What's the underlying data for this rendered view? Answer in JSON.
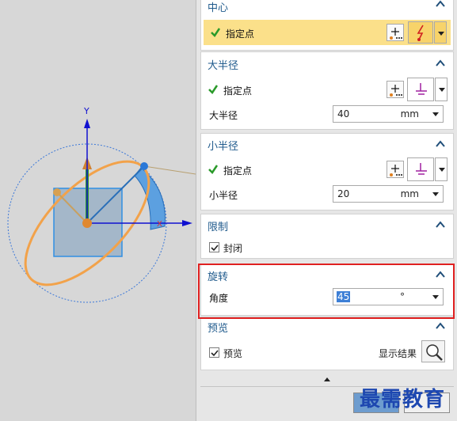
{
  "sections": {
    "center": {
      "title": "中心",
      "specify_point_label": "指定点"
    },
    "major_radius": {
      "title": "大半径",
      "specify_point_label": "指定点",
      "radius_label": "大半径",
      "radius_value": "40",
      "radius_unit": "mm"
    },
    "minor_radius": {
      "title": "小半径",
      "specify_point_label": "指定点",
      "radius_label": "小半径",
      "radius_value": "20",
      "radius_unit": "mm"
    },
    "limit": {
      "title": "限制",
      "closed_label": "封闭",
      "closed_checked": true
    },
    "rotation": {
      "title": "旋转",
      "angle_label": "角度",
      "angle_value": "45",
      "angle_unit": "°"
    },
    "preview": {
      "title": "预览",
      "preview_label": "预览",
      "preview_checked": true,
      "show_result_label": "显示结果"
    }
  },
  "viewport": {
    "y_axis_label": "Y",
    "x_axis_label": "X"
  },
  "watermark": "最需教育",
  "colors": {
    "accent": "#1f5a8c",
    "active_row": "#fbe08a",
    "highlight_border": "#e02020",
    "ellipse": "#f2a24a"
  }
}
